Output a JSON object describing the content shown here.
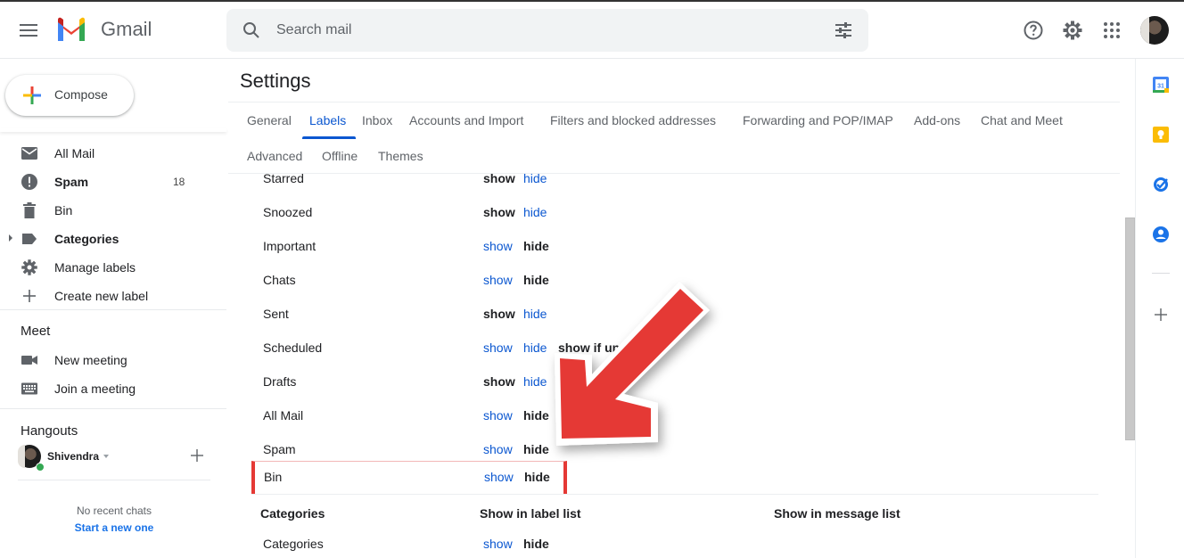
{
  "app": {
    "name": "Gmail"
  },
  "search": {
    "placeholder": "Search mail"
  },
  "header_icons": [
    "help-icon",
    "settings-icon",
    "apps-grid-icon",
    "account-avatar"
  ],
  "sidebar": {
    "compose_label": "Compose",
    "items": [
      {
        "label": "All Mail",
        "icon": "mail-icon",
        "bold": false,
        "count": ""
      },
      {
        "label": "Spam",
        "icon": "spam-icon",
        "bold": true,
        "count": "18"
      },
      {
        "label": "Bin",
        "icon": "trash-icon",
        "bold": false,
        "count": ""
      },
      {
        "label": "Categories",
        "icon": "label-icon",
        "bold": true,
        "count": ""
      },
      {
        "label": "Manage labels",
        "icon": "gear-icon",
        "bold": false,
        "count": ""
      },
      {
        "label": "Create new label",
        "icon": "plus-icon",
        "bold": false,
        "count": ""
      }
    ],
    "meet": {
      "title": "Meet",
      "items": [
        {
          "label": "New meeting",
          "icon": "video-icon"
        },
        {
          "label": "Join a meeting",
          "icon": "keyboard-icon"
        }
      ]
    },
    "hangouts": {
      "title": "Hangouts",
      "user": "Shivendra",
      "status": "online",
      "no_chats": "No recent chats",
      "start_new": "Start a new one"
    }
  },
  "settings": {
    "title": "Settings",
    "tabs": [
      {
        "label": "General",
        "active": false
      },
      {
        "label": "Labels",
        "active": true
      },
      {
        "label": "Inbox",
        "active": false
      },
      {
        "label": "Accounts and Import",
        "active": false
      },
      {
        "label": "Filters and blocked addresses",
        "active": false
      },
      {
        "label": "Forwarding and POP/IMAP",
        "active": false
      },
      {
        "label": "Add-ons",
        "active": false
      },
      {
        "label": "Chat and Meet",
        "active": false
      },
      {
        "label": "Advanced",
        "active": false
      },
      {
        "label": "Offline",
        "active": false
      },
      {
        "label": "Themes",
        "active": false
      }
    ],
    "system_labels": [
      {
        "name": "Starred",
        "selected": "show",
        "extra": ""
      },
      {
        "name": "Snoozed",
        "selected": "show",
        "extra": ""
      },
      {
        "name": "Important",
        "selected": "hide",
        "extra": ""
      },
      {
        "name": "Chats",
        "selected": "hide",
        "extra": ""
      },
      {
        "name": "Sent",
        "selected": "show",
        "extra": ""
      },
      {
        "name": "Scheduled",
        "selected": "show if unread",
        "extra": "show if unread"
      },
      {
        "name": "Drafts",
        "selected": "show",
        "extra": ""
      },
      {
        "name": "All Mail",
        "selected": "hide",
        "extra": ""
      },
      {
        "name": "Spam",
        "selected": "hide",
        "extra": ""
      },
      {
        "name": "Bin",
        "selected": "hide",
        "extra": "",
        "highlighted": true
      }
    ],
    "option_labels": {
      "show": "show",
      "hide": "hide"
    },
    "categories_header": {
      "col1": "Categories",
      "col2": "Show in label list",
      "col3": "Show in message list"
    },
    "category_rows": [
      {
        "name": "Categories",
        "selected": "hide"
      }
    ]
  },
  "side_panel": [
    "calendar-icon",
    "keep-icon",
    "tasks-icon",
    "contacts-icon",
    "add-addon-icon"
  ],
  "colors": {
    "link": "#0b57d0",
    "highlight": "#e53935",
    "annotation_arrow": "#e53935"
  }
}
